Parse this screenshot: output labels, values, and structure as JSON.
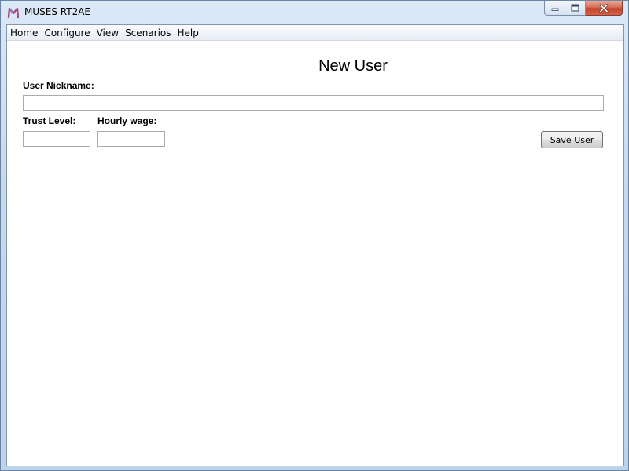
{
  "window": {
    "title": "MUSES RT2AE",
    "app_icon": "muses-logo-icon",
    "controls": [
      "minimize-icon",
      "maximize-icon",
      "close-icon"
    ]
  },
  "menu": {
    "items": [
      "Home",
      "Configure",
      "View",
      "Scenarios",
      "Help"
    ]
  },
  "form": {
    "heading": "New User",
    "nickname_label": "User Nickname:",
    "nickname_value": "",
    "trust_label": "Trust Level:",
    "trust_value": "",
    "wage_label": "Hourly wage:",
    "wage_value": "",
    "save_label": "Save User"
  },
  "colors": {
    "title_bar": "#c5d9ef",
    "close_button": "#c6452b",
    "client_bg": "#ffffff"
  }
}
